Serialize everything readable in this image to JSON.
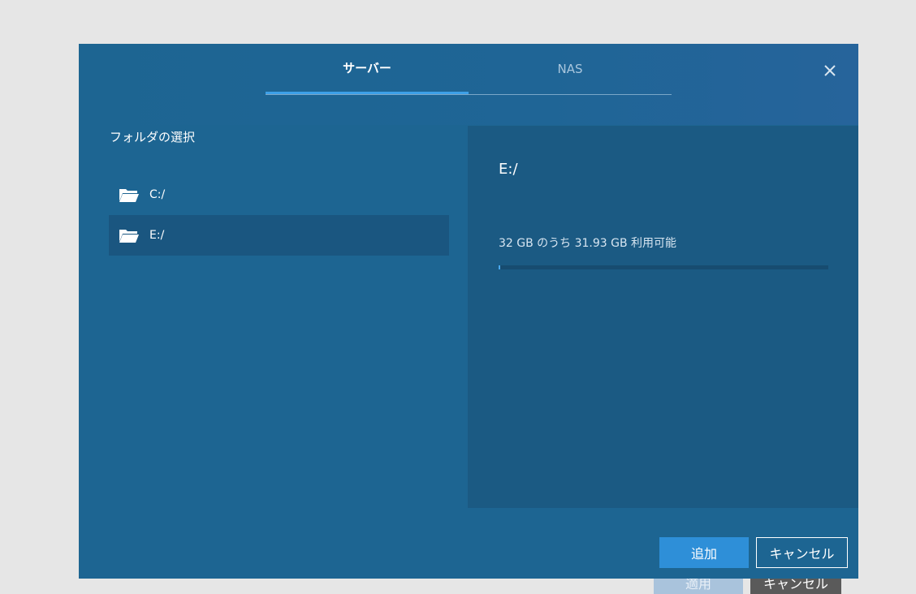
{
  "background_buttons": {
    "apply_label": "適用",
    "cancel_label": "キャンセル"
  },
  "dialog": {
    "tabs": [
      {
        "label": "サーバー",
        "active": true
      },
      {
        "label": "NAS",
        "active": false
      }
    ],
    "close_icon": "close-icon",
    "left_panel": {
      "title": "フォルダの選択",
      "folders": [
        {
          "label": "C:/",
          "icon": "folder-open-icon",
          "selected": false
        },
        {
          "label": "E:/",
          "icon": "folder-open-icon",
          "selected": true
        }
      ]
    },
    "detail": {
      "path": "E:/",
      "usage_text": "32 GB のうち 31.93 GB 利用可能",
      "used_fraction": 0.002
    },
    "buttons": {
      "add_label": "追加",
      "cancel_label": "キャンセル"
    }
  },
  "colors": {
    "dialog_bg": "#1d6592",
    "accent": "#3da0e8",
    "primary_button": "#2e8fd8"
  }
}
